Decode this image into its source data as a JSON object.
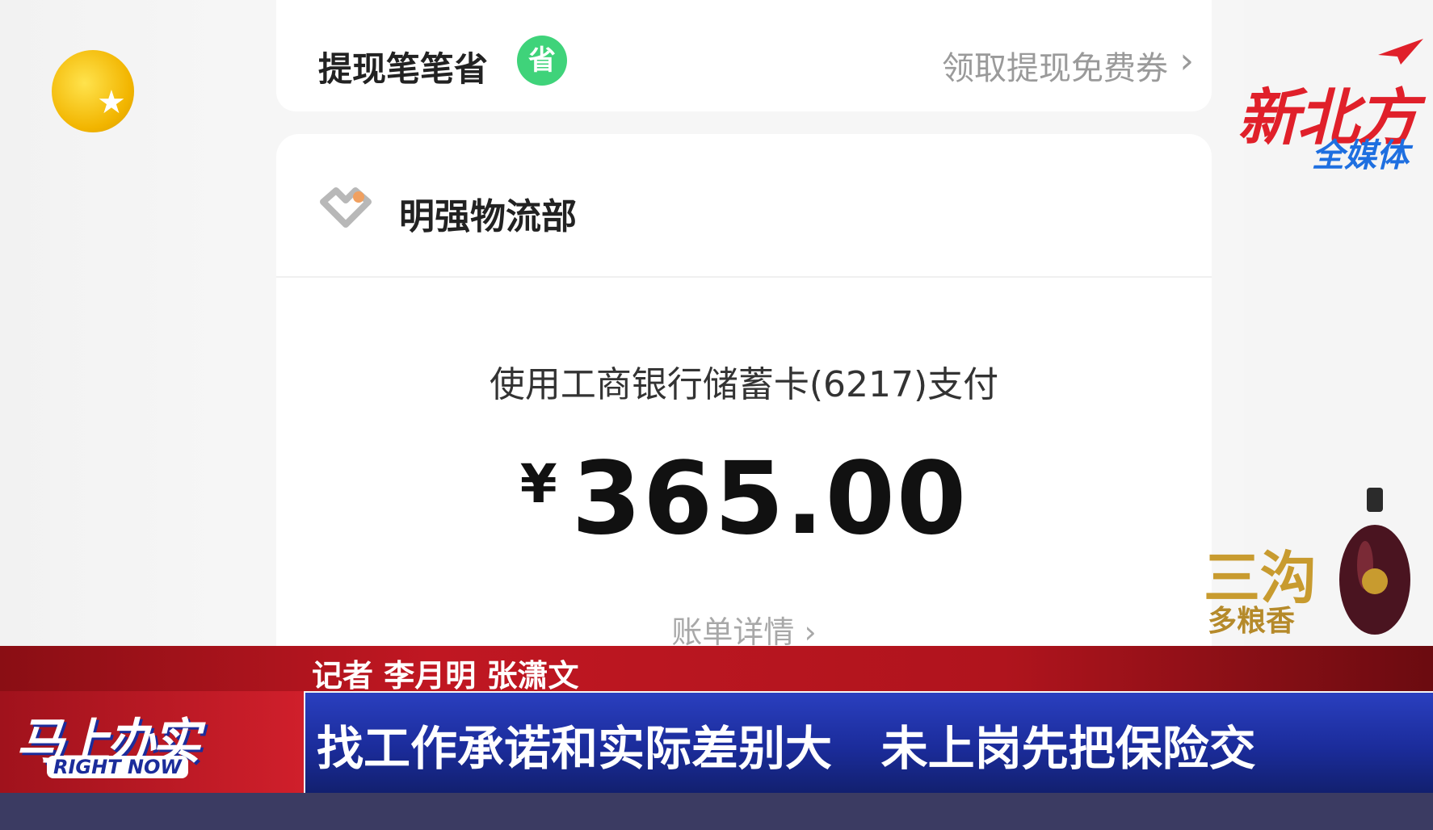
{
  "withdraw_card": {
    "title": "提现笔笔省",
    "badge": "省",
    "coupon_link": "领取提现免费券",
    "chevron": "›"
  },
  "payment_card": {
    "merchant_name": "明强物流部",
    "pay_method": "使用工商银行储蓄卡(6217)支付",
    "currency": "¥",
    "amount": "365.00",
    "bill_link": "账单详情 ›"
  },
  "broadcast": {
    "channel_brand": "新北方",
    "channel_brand_sub": "全媒体",
    "reporter_line": "记者  李月明  张潇文",
    "headline": "找工作承诺和实际差别大   未上岗先把保险交",
    "show_logo_cn": "马上办实",
    "show_logo_en": "RIGHT NOW",
    "ad_text": "三沟",
    "ad_sub": "多粮香"
  },
  "colors": {
    "accent_red": "#c01722",
    "headline_blue": "#1b2c9b",
    "badge_green": "#3fd37a"
  },
  "icons": {
    "channel_logo": "sun-star-icon",
    "merchant": "heart-link-icon",
    "plane": "paper-plane-icon"
  }
}
